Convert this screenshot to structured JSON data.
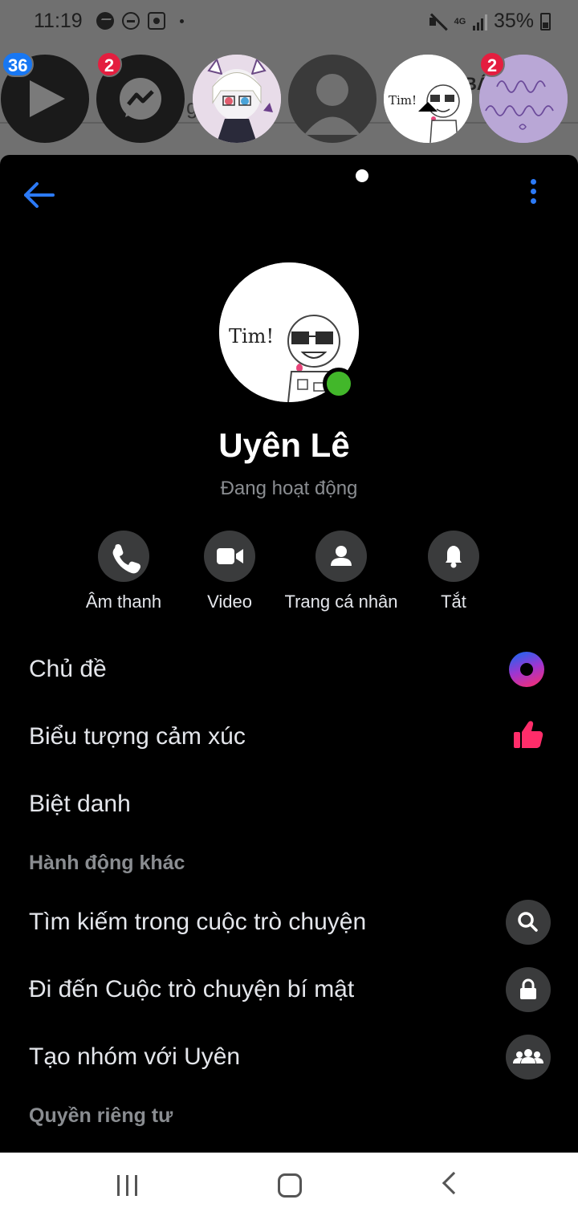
{
  "status_bar": {
    "time": "11:19",
    "network": "4G",
    "battery": "35%"
  },
  "chat_heads": {
    "badges": {
      "videos": "36",
      "messenger": "2",
      "handwriting": "2"
    },
    "background_text": "g",
    "background_text_2": "BÁ"
  },
  "profile": {
    "name": "Uyên Lê",
    "status": "Đang hoạt động"
  },
  "actions": [
    {
      "label": "Âm thanh"
    },
    {
      "label": "Video"
    },
    {
      "label": "Trang cá nhân"
    },
    {
      "label": "Tắt"
    }
  ],
  "customize": {
    "theme": "Chủ đề",
    "emoji": "Biểu tượng cảm xúc",
    "nicknames": "Biệt danh"
  },
  "more_actions": {
    "header": "Hành động khác",
    "search": "Tìm kiếm trong cuộc trò chuyện",
    "secret": "Đi đến Cuộc trò chuyện bí mật",
    "group": "Tạo nhóm với Uyên"
  },
  "privacy": {
    "header": "Quyền riêng tư"
  },
  "colors": {
    "accent": "#2c7af6",
    "online": "#42b72a",
    "like": "#ff2d6a"
  }
}
